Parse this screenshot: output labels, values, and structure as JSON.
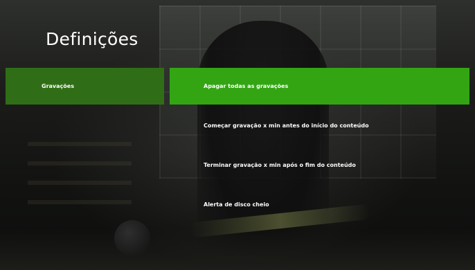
{
  "page": {
    "title": "Definições"
  },
  "sidebar": {
    "items": [
      {
        "label": "Gravações",
        "selected": true
      }
    ]
  },
  "options": [
    {
      "label": "Apagar todas as gravações",
      "focused": true
    },
    {
      "label": "Começar gravação x min antes do início do conteúdo",
      "focused": false
    },
    {
      "label": "Terminar gravação x min após o fim do conteúdo",
      "focused": false
    },
    {
      "label": "Alerta de disco cheio",
      "focused": false
    }
  ],
  "colors": {
    "focus_green": "#33a513",
    "sidebar_selected_green": "#2f6e16",
    "text": "#ffffff"
  }
}
